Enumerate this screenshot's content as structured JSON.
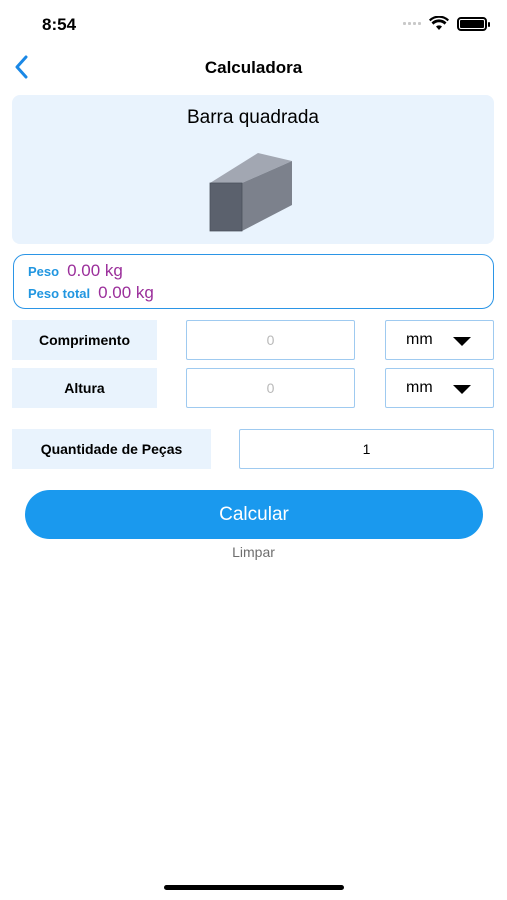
{
  "status_bar": {
    "time": "8:54",
    "signal_icon": "signal-icon",
    "wifi_icon": "wifi-icon",
    "battery_icon": "battery-icon"
  },
  "nav": {
    "title": "Calculadora",
    "back_icon": "chevron-left-icon"
  },
  "product": {
    "title": "Barra quadrada",
    "image": "square-bar-image"
  },
  "results": {
    "weight_label": "Peso",
    "weight_value": "0.00 kg",
    "total_weight_label": "Peso total",
    "total_weight_value": "0.00 kg"
  },
  "form": {
    "length": {
      "label": "Comprimento",
      "placeholder": "0",
      "unit": "mm"
    },
    "height": {
      "label": "Altura",
      "placeholder": "0",
      "unit": "mm"
    },
    "quantity": {
      "label": "Quantidade de Peças",
      "value": "1"
    }
  },
  "actions": {
    "calculate_label": "Calcular",
    "clear_label": "Limpar"
  },
  "colors": {
    "accent": "#1a99ee",
    "label_bg": "#e9f3fd",
    "input_border": "#9fcaf0",
    "result_label": "#2196e0",
    "result_value": "#9b2f9b"
  }
}
